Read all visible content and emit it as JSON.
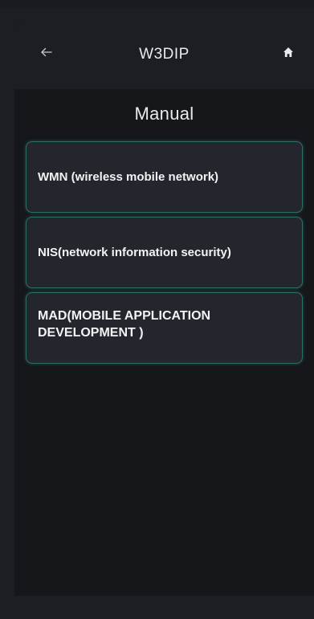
{
  "header": {
    "title": "W3DIP",
    "back_icon": "arrow-left-icon",
    "home_icon": "home-icon"
  },
  "page": {
    "title": "Manual"
  },
  "manual_items": [
    {
      "label": "WMN (wireless mobile network)"
    },
    {
      "label": "NIS(network information security)"
    },
    {
      "label": "MAD(MOBILE APPLICATION DEVELOPMENT )"
    }
  ],
  "colors": {
    "background": "#15171b",
    "header": "#1c1e23",
    "card": "#23262d",
    "card_border": "#2f6e66",
    "text": "#f2f3f5"
  }
}
